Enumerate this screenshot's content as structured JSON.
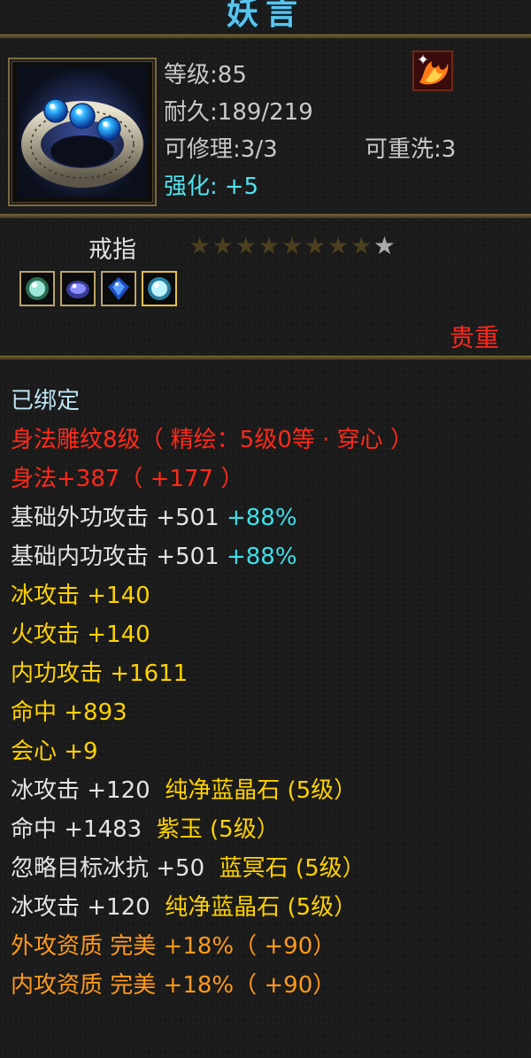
{
  "title": "妖言",
  "header": {
    "level_label": "等级",
    "level_value": ":85",
    "durability_label": "耐久",
    "durability_value": ":189/219",
    "repair_label": "可修理",
    "repair_value": ":3/3",
    "rewash_label": "可重洗",
    "rewash_value": ":3",
    "enhance_label": "强化:",
    "enhance_value": "+5",
    "item_icon": "ring-with-blue-gems-icon",
    "class_badge_icon": "phoenix-emblem-icon"
  },
  "mid": {
    "type_name": "戒指",
    "stars_total": 9,
    "stars_lit": 1,
    "gem_icons": [
      "green-gem-icon",
      "purple-gem-icon",
      "blue-gem-icon",
      "cyan-gem-icon"
    ],
    "rarity": "贵重"
  },
  "attributes": {
    "bound": "已绑定",
    "carving": "身法雕纹8级（ 精绘：5级0等 · 穿心 ）",
    "agility": "身法+387（ +177 ）",
    "outer_attack": {
      "label": "基础外功攻击",
      "value": " +501",
      "pct": "+88%"
    },
    "inner_attack": {
      "label": "基础内功攻击",
      "value": " +501",
      "pct": "+88%"
    },
    "ice_attack": "冰攻击 +140",
    "fire_attack": "火攻击 +140",
    "inner_power_attack": "内功攻击 +1611",
    "hit": "命中 +893",
    "crit": "会心 +9",
    "gem1": {
      "stat": "冰攻击 +120",
      "name": "纯净蓝晶石 (5级）"
    },
    "gem2": {
      "stat": "命中 +1483",
      "name": "紫玉 (5级）"
    },
    "gem3": {
      "stat": "忽略目标冰抗 +50",
      "name": "蓝冥石 (5级）"
    },
    "gem4": {
      "stat": "冰攻击 +120",
      "name": "纯净蓝晶石 (5级）"
    },
    "outer_quality": "外攻资质   完美 +18%（ +90）",
    "inner_quality": "内攻资质   完美 +18%（ +90）"
  },
  "colors": {
    "title": "#59c5ee",
    "enhance": "#4fe4ee",
    "rarity": "#ff2a1e",
    "red_attr": "#ff2a1a",
    "yellow_attr": "#ffd200",
    "orange_attr": "#ff9a1a",
    "cyan_pct": "#3fe0ea"
  }
}
